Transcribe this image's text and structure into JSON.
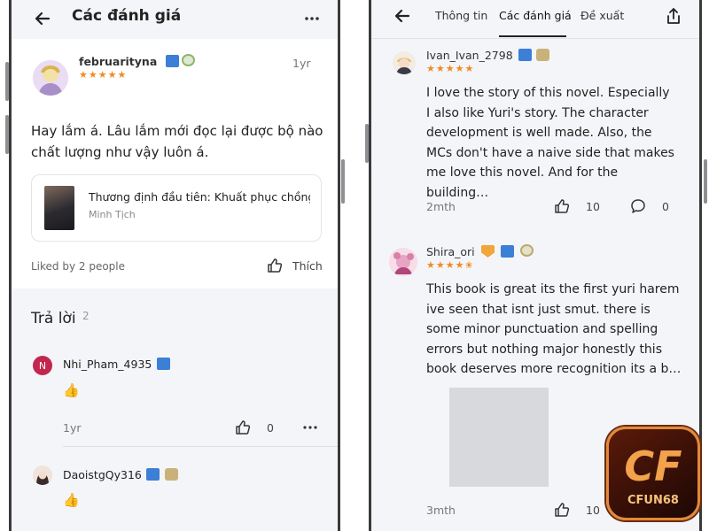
{
  "left": {
    "header": {
      "title": "Các đánh giá"
    },
    "review": {
      "username": "februarityna",
      "rating": "★★★★★",
      "time": "1yr",
      "text_line1": "Hay lắm á. Lâu lắm mới đọc lại được bộ nào",
      "text_line2": "chất lượng như vậy luôn á.",
      "book_title": "Thương định đầu tiên: Khuất phục chồng",
      "book_author": "Minh Tịch",
      "liked_by": "Liked by 2 people",
      "like_label": "Thích"
    },
    "replies": {
      "title": "Trả lời",
      "count": "2",
      "items": [
        {
          "initial": "N",
          "name": "Nhi_Pham_4935",
          "emoji": "👍",
          "time": "1yr",
          "likes": "0"
        },
        {
          "initial": "",
          "name": "DaoistgQy316",
          "emoji": "👍"
        }
      ]
    }
  },
  "right": {
    "tabs": [
      "Thông tin",
      "Các đánh giá",
      "Đề xuất"
    ],
    "reviews": [
      {
        "username": "Ivan_Ivan_2798",
        "rating": "★★★★★",
        "lines": [
          "I love the story of this novel. Especially",
          "I also like Yuri's story. The character",
          "development is well made. Also, the",
          "MCs don't have a naive side that makes",
          "me love this novel. And for the building…"
        ],
        "time": "2mth",
        "likes": "10",
        "comments": "0"
      },
      {
        "username": "Shira_ori",
        "rating": "★★★★✬",
        "lines": [
          "This book is great its the first yuri harem",
          "ive seen that isnt just smut. there is",
          "some minor punctuation and spelling",
          "errors but nothing major honestly this",
          "book deserves more recognition its a b…"
        ],
        "time": "3mth",
        "likes": "10"
      }
    ]
  },
  "watermark": {
    "text": "CFUN68"
  },
  "colors": {
    "star": "#f08a24",
    "badge_blue": "#3b7fd6",
    "bg_gray": "#f4f5f8"
  }
}
